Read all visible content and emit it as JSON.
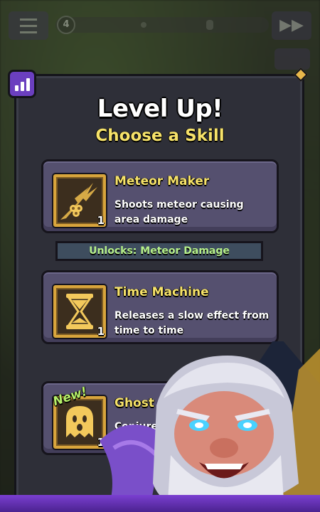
{
  "hud": {
    "wave_number": "4",
    "menu_icon": "hamburger-icon",
    "fast_forward_icon": "fast-forward-icon"
  },
  "dialog": {
    "title": "Level Up!",
    "subtitle": "Choose a Skill",
    "stats_icon": "bar-chart-icon"
  },
  "skills": [
    {
      "name": "Meteor Maker",
      "description": "Shoots meteor causing area damage",
      "level": "1",
      "icon": "meteor-icon",
      "unlocks": "Unlocks: Meteor Damage"
    },
    {
      "name": "Time Machine",
      "description": "Releases a slow effect from time to time",
      "level": "1",
      "icon": "hourglass-icon"
    },
    {
      "name": "Ghost A",
      "description": "Conjure",
      "level": "1",
      "icon": "ghost-icon",
      "badge": "New!"
    }
  ],
  "colors": {
    "accent_yellow": "#f7e36a",
    "card_bg": "#55506f",
    "panel_bg": "#2e2f38",
    "frame_gold": "#d9a53c",
    "unlock_text": "#b6f08a",
    "purple": "#6b3fbf"
  }
}
